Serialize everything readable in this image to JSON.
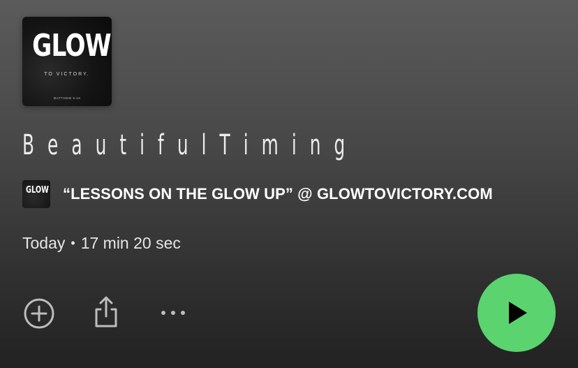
{
  "cover_art": {
    "brand": "GLOW",
    "subtitle": "TO VICTORY.",
    "verse": "MATTHEW 5:16"
  },
  "episode": {
    "title": "B e a u t i f u l T i m i n g",
    "date": "Today",
    "separator": "•",
    "duration": "17 min 20 sec"
  },
  "show": {
    "thumb_text": "GLOW",
    "name": "“LESSONS ON THE GLOW UP” @ GLOWTOVICTORY.COM"
  },
  "actions": {
    "add_icon": "plus-circle-icon",
    "share_icon": "share-icon",
    "more_icon": "more-horizontal-icon",
    "play_icon": "play-icon"
  },
  "colors": {
    "play_button": "#5bd36e",
    "icon": "#bdbdbd"
  }
}
